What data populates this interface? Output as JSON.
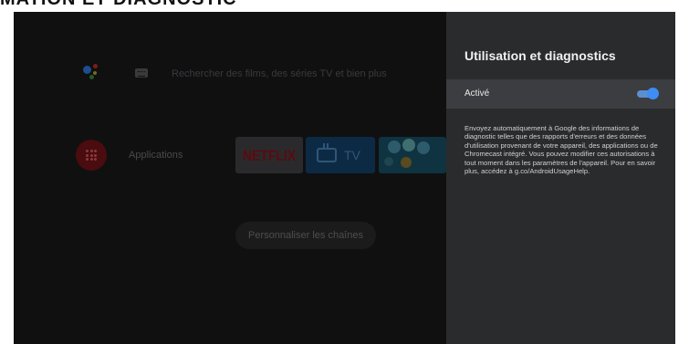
{
  "page": {
    "heading": "MATION ET DIAGNOSTIC"
  },
  "home": {
    "search_placeholder": "Rechercher des films, des séries TV et bien plus",
    "apps_label": "Applications",
    "tiles": [
      {
        "label": "NETFLIX"
      },
      {
        "label": "TV"
      }
    ],
    "personalize_label": "Personnaliser les chaînes"
  },
  "panel": {
    "title": "Utilisation et diagnostics",
    "toggle_label": "Activé",
    "toggle_on": true,
    "description": "Envoyez automatiquement à Google des informations de diagnostic telles que des rapports d'erreurs et des données d'utilisation provenant de votre appareil, des applications ou de Chromecast intégré. Vous pouvez modifier ces autorisations à tout moment dans les paramètres de l'appareil. Pour en savoir plus, accédez à g.co/AndroidUsageHelp."
  },
  "colors": {
    "panel_bg": "#2a2b2d",
    "accent": "#3d8df5"
  },
  "icons": [
    "google-assistant-icon",
    "keyboard-icon",
    "apps-grid-icon",
    "tv-icon"
  ]
}
